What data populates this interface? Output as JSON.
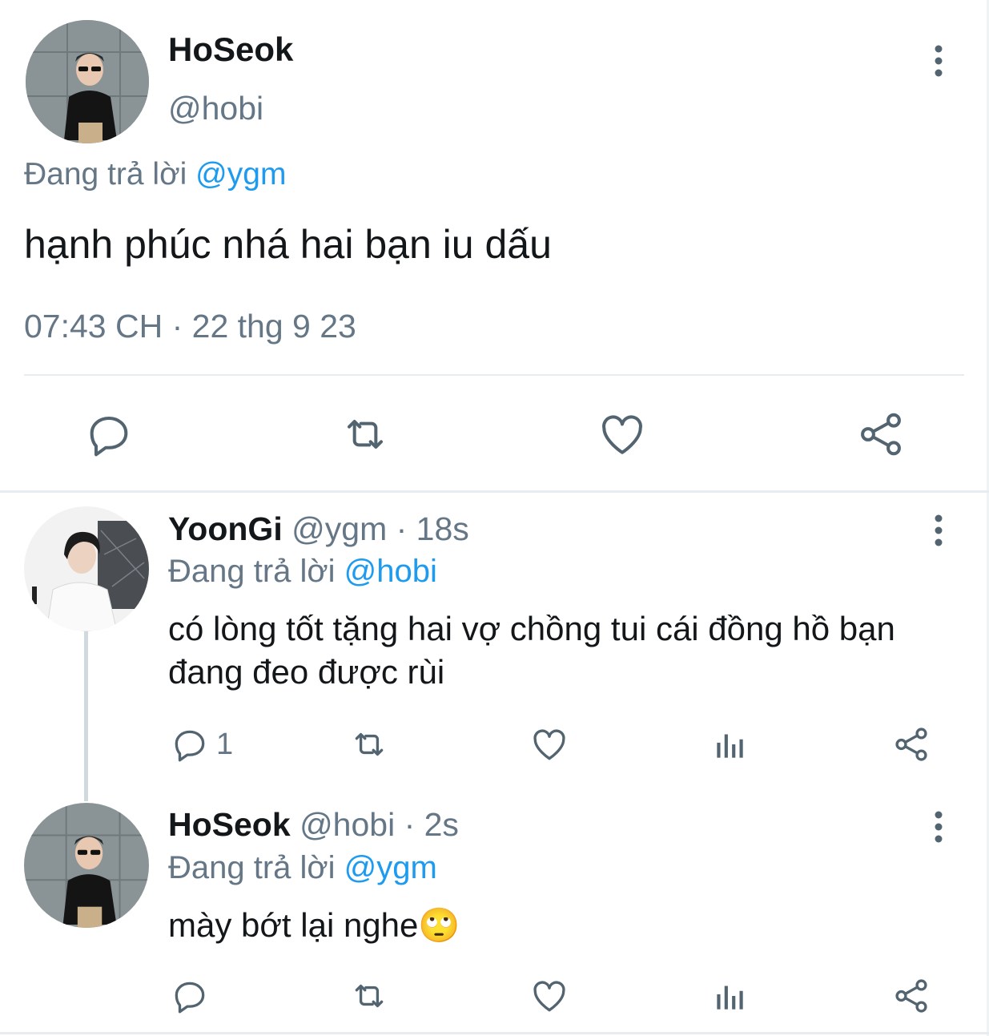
{
  "main_tweet": {
    "name": "HoSeok",
    "handle": "@hobi",
    "replying_prefix": "Đang trả lời",
    "replying_to": "@ygm",
    "text": "hạnh phúc nhá hai bạn iu dấu",
    "timestamp": "07:43 CH · 22 thg 9 23",
    "icons": [
      "reply-icon",
      "retweet-icon",
      "like-icon",
      "share-icon",
      "more-icon"
    ]
  },
  "replies": [
    {
      "name": "YoonGi",
      "handle_time": "@ygm · 18s",
      "replying_prefix": "Đang trả lời",
      "replying_to": "@hobi",
      "text": "có lòng tốt tặng hai vợ chồng tui cái đồng hồ bạn đang đeo được rùi",
      "reply_count": "1"
    },
    {
      "name": "HoSeok",
      "handle_time": "@hobi · 2s",
      "replying_prefix": "Đang trả lời",
      "replying_to": "@ygm",
      "text": "mày bớt lại nghe🙄",
      "reply_count": ""
    }
  ],
  "colors": {
    "accent": "#1d9bf0",
    "secondary_text": "#657786",
    "icon": "#536471"
  }
}
